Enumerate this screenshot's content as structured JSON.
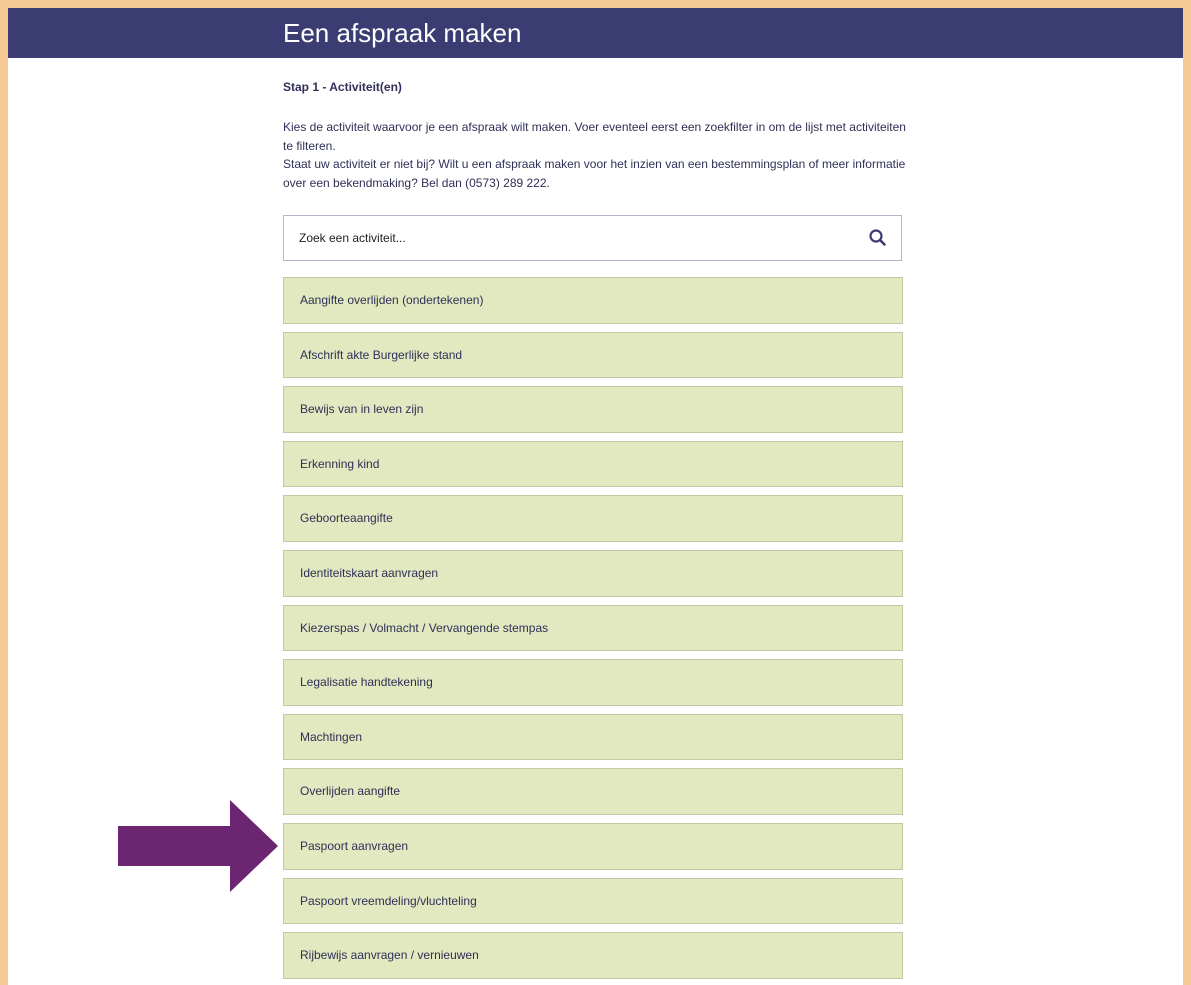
{
  "header": {
    "title": "Een afspraak maken"
  },
  "step": {
    "label": "Stap 1 - Activiteit(en)"
  },
  "intro": {
    "line1": "Kies de activiteit waarvoor je een afspraak wilt maken. Voer eventeel eerst een zoekfilter in om de lijst met activiteiten te filteren.",
    "line2": "Staat uw activiteit er niet bij? Wilt u een afspraak maken voor het inzien van een bestemmingsplan of meer informatie over een bekendmaking? Bel dan (0573) 289 222."
  },
  "search": {
    "placeholder": "Zoek een activiteit...",
    "value": "",
    "icon": "search-icon"
  },
  "activities": [
    {
      "label": "Aangifte overlijden (ondertekenen)"
    },
    {
      "label": "Afschrift akte Burgerlijke stand"
    },
    {
      "label": "Bewijs van in leven zijn"
    },
    {
      "label": "Erkenning kind"
    },
    {
      "label": "Geboorteaangifte"
    },
    {
      "label": "Identiteitskaart aanvragen"
    },
    {
      "label": "Kiezerspas / Volmacht / Vervangende stempas"
    },
    {
      "label": "Legalisatie handtekening"
    },
    {
      "label": "Machtingen"
    },
    {
      "label": "Overlijden aangifte"
    },
    {
      "label": "Paspoort aanvragen"
    },
    {
      "label": "Paspoort vreemdeling/vluchteling"
    },
    {
      "label": "Rijbewijs aanvragen / vernieuwen"
    }
  ],
  "colors": {
    "frame": "#f4c993",
    "header_bg": "#3a3c72",
    "item_bg": "#e2e8bf",
    "text": "#2f3057",
    "arrow": "#6b2571"
  },
  "annotation": {
    "icon": "arrow-right-icon",
    "points_to": "Paspoort aanvragen"
  }
}
